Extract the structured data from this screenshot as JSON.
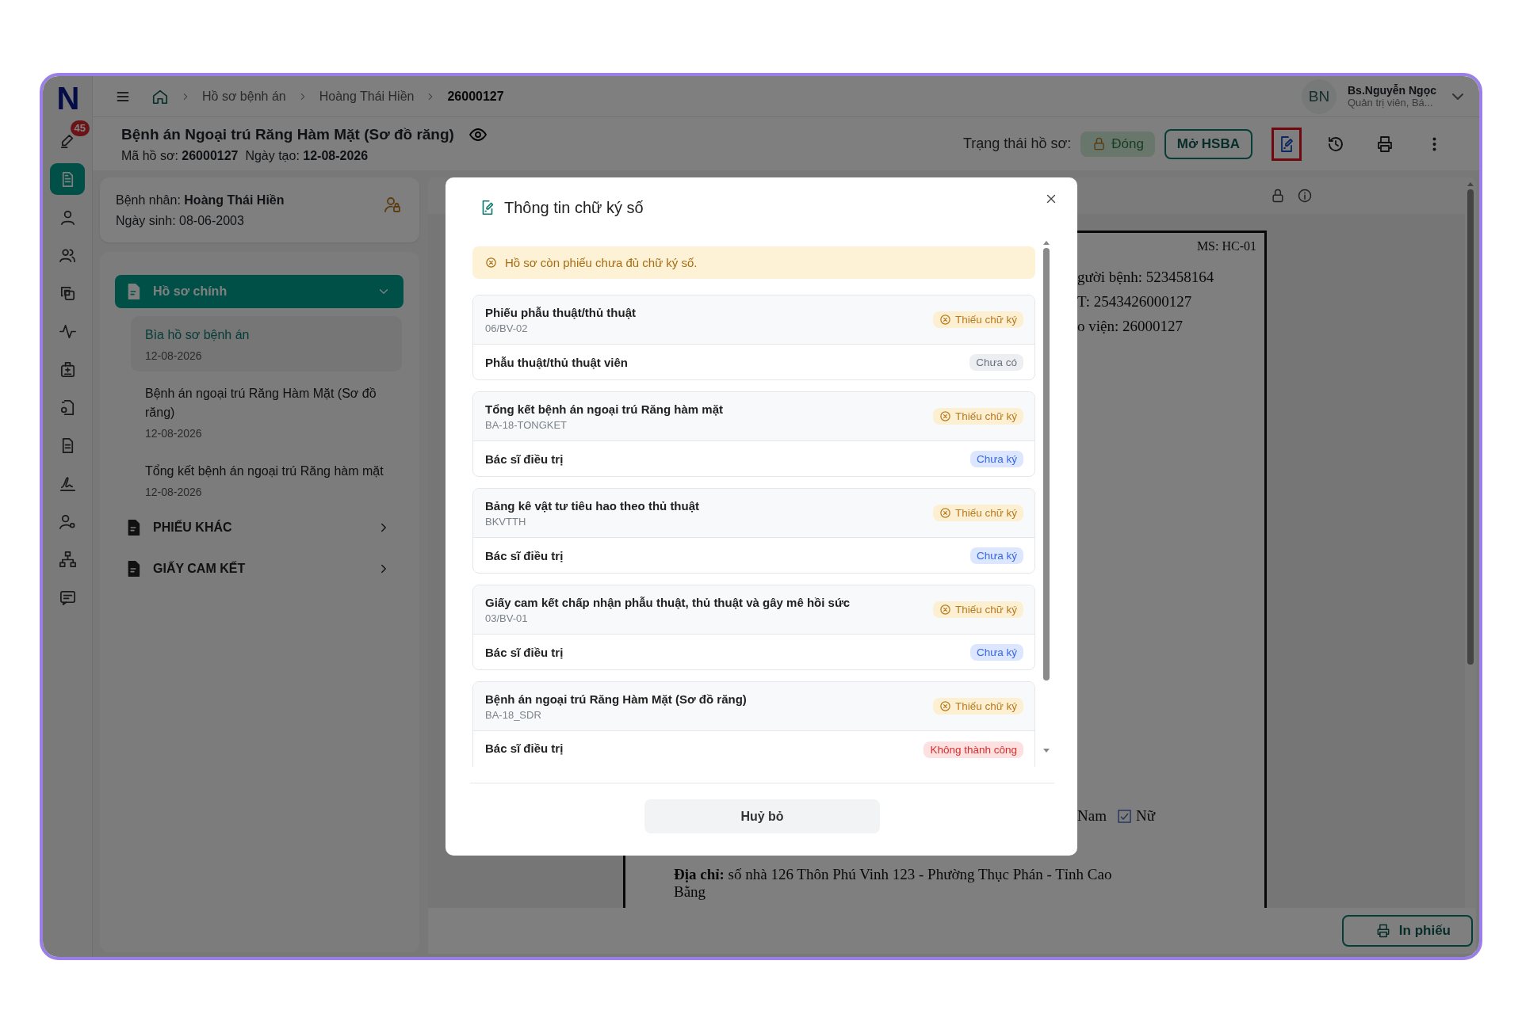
{
  "logo": "N",
  "rail": [
    {
      "badge": "45",
      "selected": false
    },
    {
      "selected": true
    },
    {
      "selected": false
    },
    {
      "selected": false
    },
    {
      "selected": false
    },
    {
      "selected": false
    },
    {
      "selected": false
    },
    {
      "selected": false
    },
    {
      "selected": false
    },
    {
      "selected": false
    },
    {
      "selected": false
    },
    {
      "selected": false
    },
    {
      "selected": false
    }
  ],
  "breadcrumbs": [
    {
      "label": "Hồ sơ bệnh án",
      "current": false
    },
    {
      "label": "Hoàng Thái Hiền",
      "current": false
    },
    {
      "label": "26000127",
      "current": true
    }
  ],
  "user": {
    "initials": "BN",
    "name": "Bs.Nguyễn Ngọc",
    "role": "Quản trị viên, Bá..."
  },
  "record": {
    "title": "Bệnh án Ngoại trú Răng Hàm Mặt (Sơ đồ răng)",
    "meta": "Mã hồ sơ: **26000127**  Ngày tạo: **12-08-2026**",
    "status_label": "Trạng thái hồ sơ:",
    "status": "Đóng",
    "open_button": "Mở HSBA"
  },
  "toolbar": [
    {
      "highlighted": true
    },
    {
      "highlighted": false
    },
    {
      "highlighted": false
    },
    {
      "highlighted": false
    }
  ],
  "patient": {
    "name": "Bệnh nhân: **Hoàng Thái Hiền**",
    "birth": "Ngày sinh: 08-06-2003"
  },
  "folders": [
    {
      "label": "Hồ sơ chính",
      "selected": true,
      "expanded": true,
      "children": [
        {
          "title": "Bìa hồ sơ bệnh án",
          "date": "12-08-2026",
          "selected": true
        },
        {
          "title": "Bệnh án ngoại trú Răng Hàm Mặt (Sơ đồ răng)",
          "date": "12-08-2026",
          "selected": false
        },
        {
          "title": "Tổng kết bệnh án ngoại trú Răng hàm mặt",
          "date": "12-08-2026",
          "selected": false
        }
      ]
    },
    {
      "label": "PHIẾU KHÁC",
      "selected": false,
      "expanded": false
    },
    {
      "label": "GIẤY CAM KẾT",
      "selected": false,
      "expanded": false
    }
  ],
  "document": {
    "code": "MS: HC-01",
    "lines": [
      "gười bệnh: 523458164",
      "T: 2543426000127",
      "o viện: 26000127"
    ],
    "gender_tail": "Nam",
    "female": {
      "label": "Nữ",
      "checked": true
    },
    "address": "**Địa chỉ:** số nhà 126 Thôn Phú Vinh 123 - Phường Thục Phán - Tỉnh Cao Bằng"
  },
  "print_button": "In phiếu",
  "modal": {
    "title": "Thông tin chữ ký số",
    "alert": "Hồ sơ còn phiếu chưa đủ chữ ký số.",
    "forms": [
      {
        "title": "Phiếu phẫu thuật/thủ thuật",
        "code": "06/BV-02",
        "status": {
          "kind": "missing",
          "label": "Thiếu chữ ký"
        },
        "signers": [
          {
            "role": "Phẫu thuật/thủ thuật viên",
            "status": {
              "kind": "none",
              "label": "Chưa có"
            }
          }
        ]
      },
      {
        "title": "Tổng kết bệnh án ngoại trú Răng hàm mặt",
        "code": "BA-18-TONGKET",
        "status": {
          "kind": "missing",
          "label": "Thiếu chữ ký"
        },
        "signers": [
          {
            "role": "Bác sĩ điều trị",
            "status": {
              "kind": "unsigned",
              "label": "Chưa ký"
            }
          }
        ]
      },
      {
        "title": "Bảng kê vật tư tiêu hao theo thủ thuật",
        "code": "BKVTTH",
        "status": {
          "kind": "missing",
          "label": "Thiếu chữ ký"
        },
        "signers": [
          {
            "role": "Bác sĩ điều trị",
            "status": {
              "kind": "unsigned",
              "label": "Chưa ký"
            }
          }
        ]
      },
      {
        "title": "Giấy cam kết chấp nhận phẫu thuật, thủ thuật và gây mê hồi sức",
        "code": "03/BV-01",
        "status": {
          "kind": "missing",
          "label": "Thiếu chữ ký"
        },
        "signers": [
          {
            "role": "Bác sĩ điều trị",
            "status": {
              "kind": "unsigned",
              "label": "Chưa ký"
            }
          }
        ]
      },
      {
        "title": "Bệnh án ngoại trú Răng Hàm Mặt (Sơ đồ răng)",
        "code": "BA-18_SDR",
        "status": {
          "kind": "missing",
          "label": "Thiếu chữ ký"
        },
        "signers": [
          {
            "role": "Bác sĩ điều trị",
            "status": {
              "kind": "failed",
              "label": "Không thành công"
            }
          }
        ]
      }
    ],
    "cancel": "Huỷ bỏ"
  }
}
